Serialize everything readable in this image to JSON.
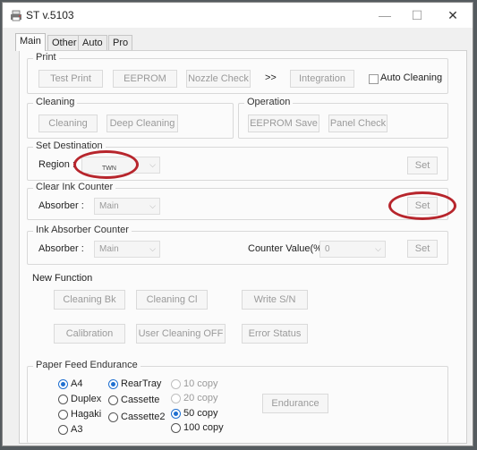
{
  "window": {
    "title": "ST v.5103",
    "controls": {
      "minimize": "—",
      "maximize": "☐",
      "close": "✕"
    }
  },
  "tabs": [
    {
      "label": "Main",
      "active": true
    },
    {
      "label": "Other",
      "active": false
    },
    {
      "label": "Auto",
      "active": false
    },
    {
      "label": "Pro",
      "active": false
    }
  ],
  "print": {
    "title": "Print",
    "buttons": [
      "Test Print",
      "EEPROM",
      "Nozzle Check",
      "Integration"
    ],
    "arrows": ">>",
    "auto_cleaning": "Auto Cleaning"
  },
  "cleaning": {
    "title": "Cleaning",
    "buttons": [
      "Cleaning",
      "Deep Cleaning"
    ]
  },
  "operation": {
    "title": "Operation",
    "buttons": [
      "EEPROM Save",
      "Panel Check"
    ]
  },
  "set_destination": {
    "title": "Set Destination",
    "region_label": "Region :",
    "region_value": "TWN",
    "set_button": "Set"
  },
  "clear_ink_counter": {
    "title": "Clear Ink Counter",
    "absorber_label": "Absorber :",
    "absorber_value": "Main",
    "set_button": "Set"
  },
  "ink_absorber_counter": {
    "title": "Ink Absorber Counter",
    "absorber_label": "Absorber :",
    "absorber_value": "Main",
    "counter_label": "Counter Value(%) :",
    "counter_value": "0",
    "set_button": "Set"
  },
  "new_function": {
    "title": "New Function",
    "buttons": [
      "Cleaning Bk",
      "Cleaning Cl",
      "Write S/N",
      "Calibration",
      "User Cleaning OFF",
      "Error Status"
    ]
  },
  "paper_feed": {
    "title": "Paper Feed Endurance",
    "sizes": [
      "A4",
      "Duplex",
      "Hagaki",
      "A3"
    ],
    "sources": [
      "RearTray",
      "Cassette",
      "Cassette2"
    ],
    "copies": [
      "10 copy",
      "20 copy",
      "50 copy",
      "100 copy"
    ],
    "endurance_button": "Endurance"
  },
  "colors": {
    "accent": "#1f6fd0",
    "highlight": "#b7252c"
  }
}
